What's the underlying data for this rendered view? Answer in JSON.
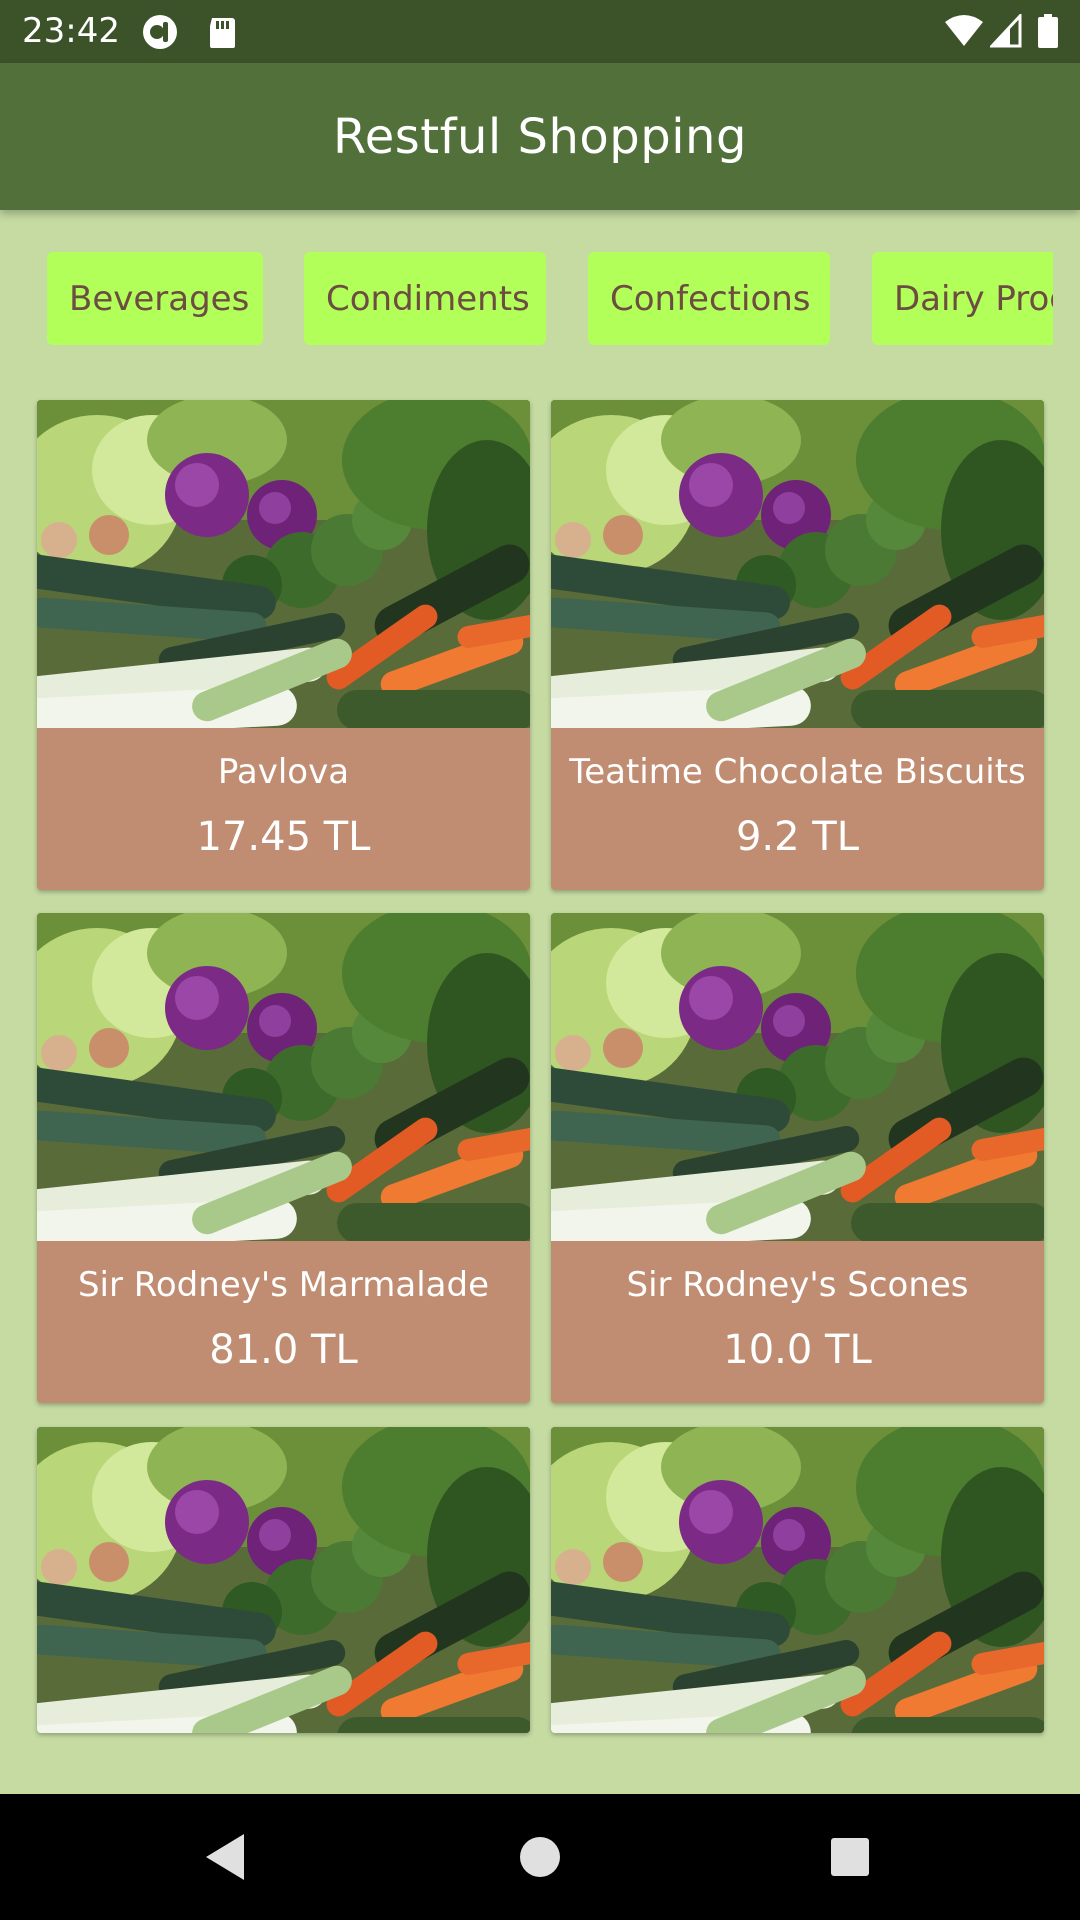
{
  "status_bar": {
    "time": "23:42",
    "left_icons": [
      "podcast-app-icon",
      "sd-card-icon"
    ],
    "right_icons": [
      "wifi-icon",
      "cell-signal-icon",
      "battery-icon"
    ]
  },
  "app_bar": {
    "title": "Restful Shopping"
  },
  "categories": [
    "Beverages",
    "Condiments",
    "Confections",
    "Dairy Products"
  ],
  "products": [
    {
      "name": "Pavlova",
      "price": "17.45 TL"
    },
    {
      "name": "Teatime Chocolate Biscuits",
      "price": "9.2 TL"
    },
    {
      "name": "Sir Rodney's Marmalade",
      "price": "81.0 TL"
    },
    {
      "name": "Sir Rodney's Scones",
      "price": "10.0 TL"
    },
    {
      "name": "",
      "price": ""
    },
    {
      "name": "",
      "price": ""
    }
  ],
  "nav_bar": {
    "buttons": [
      "back-icon",
      "home-icon",
      "recents-icon"
    ]
  },
  "colors": {
    "status_bar": "#3c5229",
    "app_bar": "#51703a",
    "background": "#c5dba2",
    "chip": "#b2ff59",
    "chip_text": "#6d4c41",
    "card": "#c08d72"
  }
}
